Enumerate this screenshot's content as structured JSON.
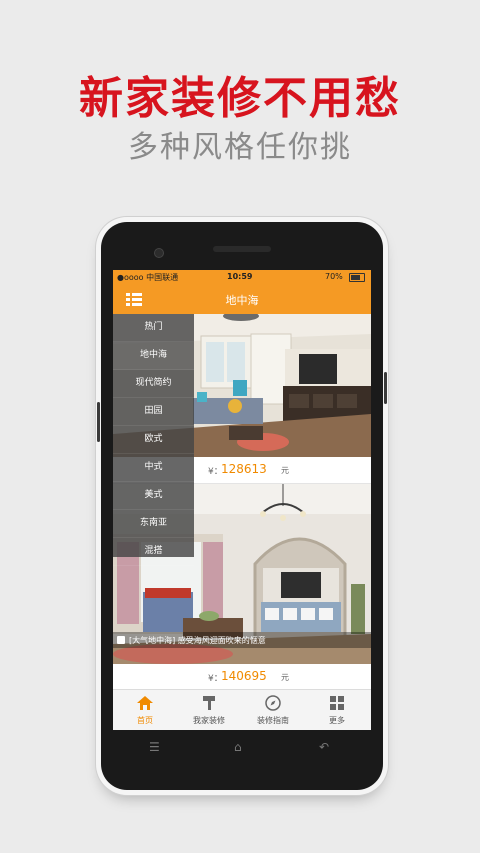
{
  "headline": "新家装修不用愁",
  "subline": "多种风格任你挑",
  "status": {
    "carrier": "●oooo 中国联通",
    "time": "10:59",
    "battery": "70%"
  },
  "nav": {
    "title": "地中海"
  },
  "side_menu": [
    "热门",
    "地中海",
    "现代简约",
    "田园",
    "欧式",
    "中式",
    "美式",
    "东南亚",
    "混搭"
  ],
  "listings": [
    {
      "currency": "¥：",
      "price": "128613",
      "unit": "元"
    },
    {
      "currency": "¥：",
      "price": "140695",
      "unit": "元",
      "caption": "[大气地中海] 感受海风迎面吹来的惬意"
    }
  ],
  "tabs": [
    {
      "label": "首页",
      "icon": "home-icon"
    },
    {
      "label": "我家装修",
      "icon": "hammer-icon"
    },
    {
      "label": "装修指南",
      "icon": "compass-icon"
    },
    {
      "label": "更多",
      "icon": "grid-icon"
    }
  ],
  "colors": {
    "accent": "#f59a24",
    "headline": "#d7141e",
    "price": "#f08a00"
  }
}
